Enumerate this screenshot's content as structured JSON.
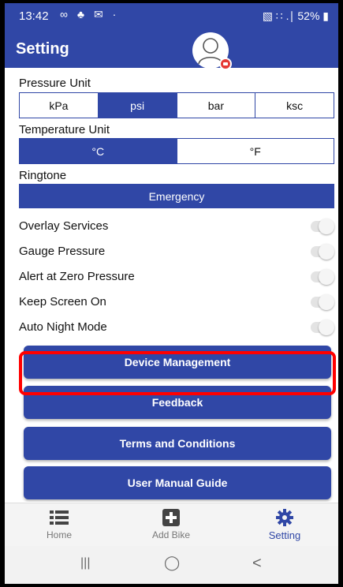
{
  "status": {
    "time": "13:42",
    "left_icons": "∞ ♣ ✉ ·",
    "right_icons": "▧ ∷ .∣ 52% ▮"
  },
  "header": {
    "title": "Setting"
  },
  "pressure": {
    "label": "Pressure Unit",
    "options": [
      "kPa",
      "psi",
      "bar",
      "ksc"
    ],
    "selected": "psi"
  },
  "temperature": {
    "label": "Temperature Unit",
    "options": [
      "°C",
      "°F"
    ],
    "selected": "°C"
  },
  "ringtone": {
    "label": "Ringtone",
    "value": "Emergency"
  },
  "toggles": [
    {
      "label": "Overlay Services",
      "on": false
    },
    {
      "label": "Gauge Pressure",
      "on": false
    },
    {
      "label": "Alert at Zero Pressure",
      "on": false
    },
    {
      "label": "Keep Screen On",
      "on": false
    },
    {
      "label": "Auto Night Mode",
      "on": false
    }
  ],
  "buttons": {
    "device": "Device Management",
    "feedback": "Feedback",
    "terms": "Terms and Conditions",
    "manual": "User Manual Guide"
  },
  "nav": {
    "home": "Home",
    "add_bike": "Add Bike",
    "setting": "Setting"
  },
  "sysnav": {
    "recents": "|||",
    "home": "◯",
    "back": "<"
  },
  "colors": {
    "primary": "#3047a6",
    "highlight": "#ff0000"
  }
}
